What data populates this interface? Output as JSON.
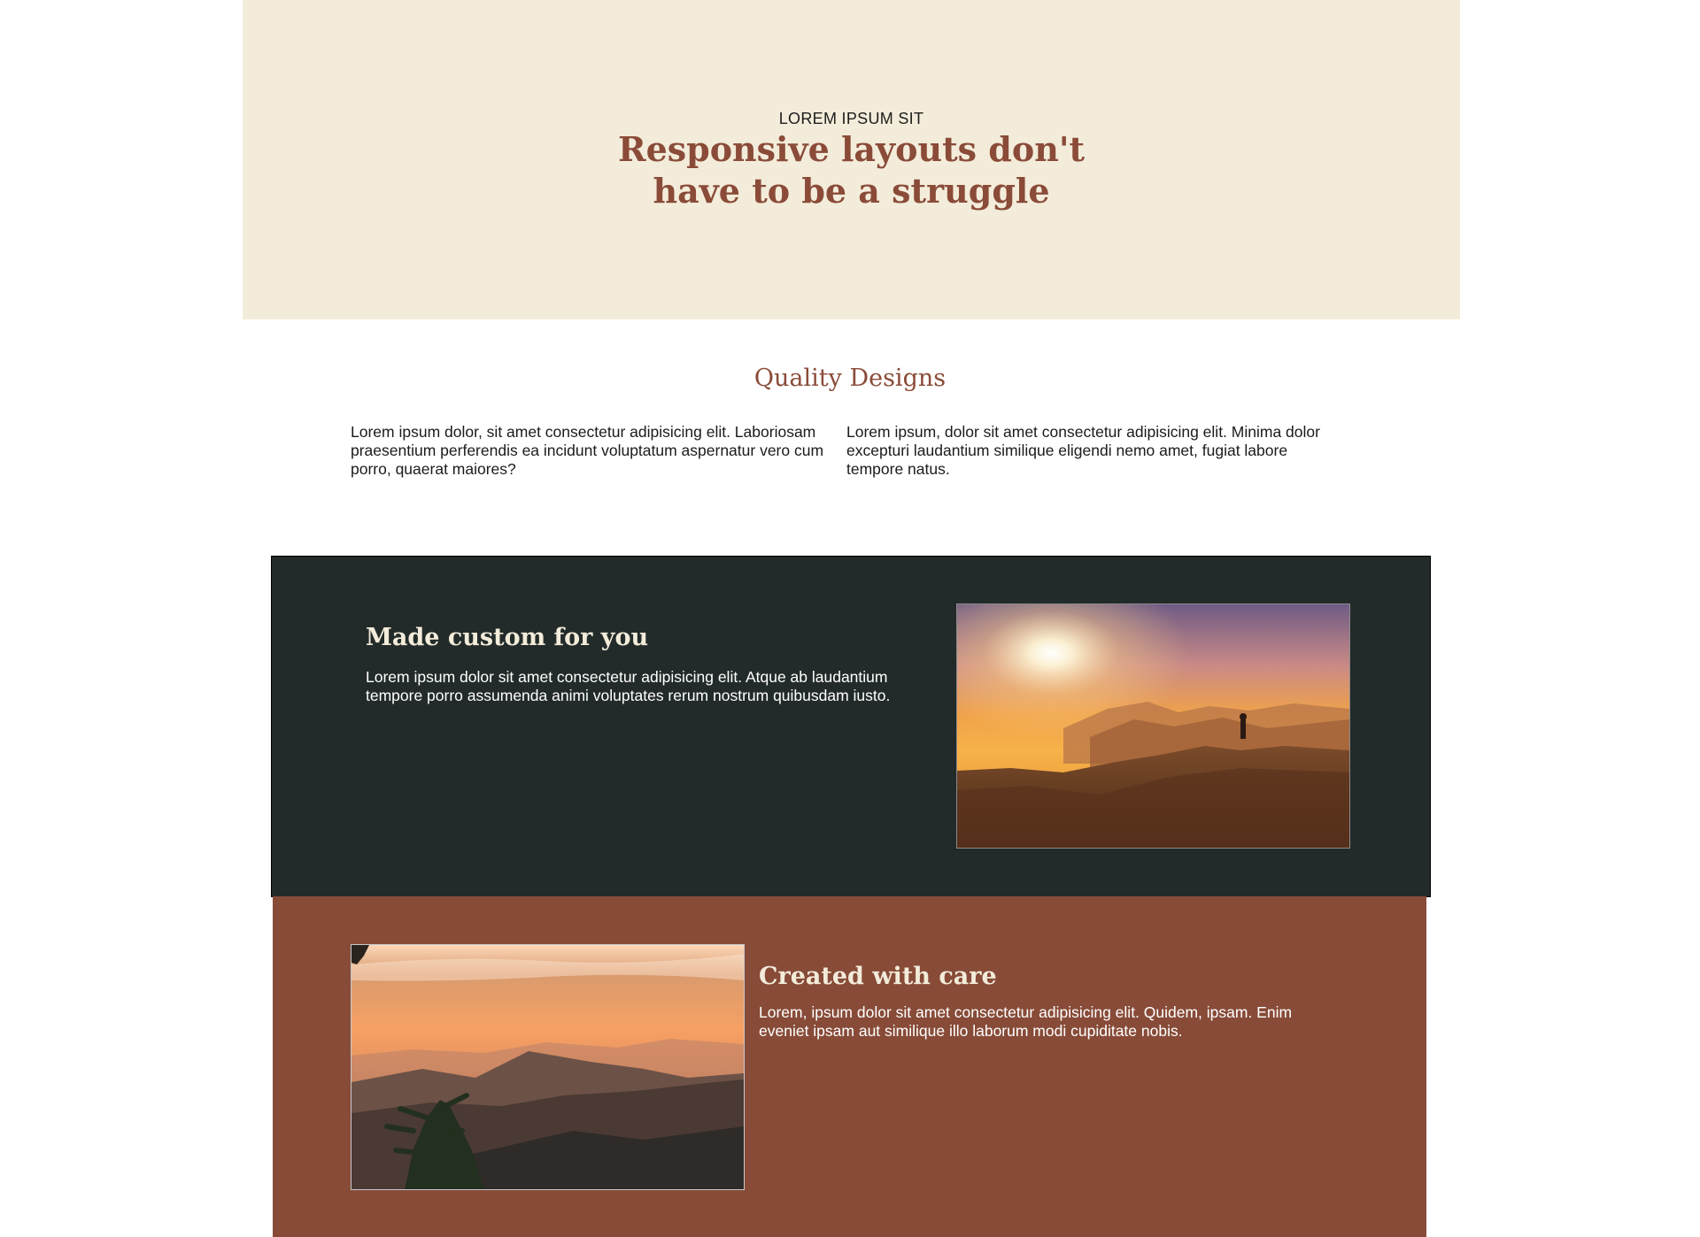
{
  "hero": {
    "kicker": "LOREM IPSUM SIT",
    "title_line1": "Responsive layouts don't",
    "title_line2": "have to be a struggle"
  },
  "quality": {
    "title": "Quality Designs",
    "col1": "Lorem ipsum dolor, sit amet consectetur adipisicing elit. Laboriosam praesentium perferendis ea incidunt voluptatum aspernatur vero cum porro, quaerat maiores?",
    "col2": "Lorem ipsum, dolor sit amet consectetur adipisicing elit. Minima dolor excepturi laudantium similique eligendi nemo amet, fugiat labore tempore natus."
  },
  "feature1": {
    "title": "Made custom for you",
    "text": "Lorem ipsum dolor sit amet consectetur adipisicing elit. Atque ab laudantium tempore porro assumenda animi voluptates rerum nostrum quibusdam iusto."
  },
  "feature2": {
    "title": "Created with care",
    "text": "Lorem, ipsum dolor sit amet consectetur adipisicing elit. Quidem, ipsam. Enim eveniet ipsam aut similique illo laborum modi cupiditate nobis."
  },
  "colors": {
    "hero_bg": "#f3ecda",
    "accent": "#8a4b38",
    "dark_section": "#232b2a",
    "brown_section": "#874b38"
  }
}
